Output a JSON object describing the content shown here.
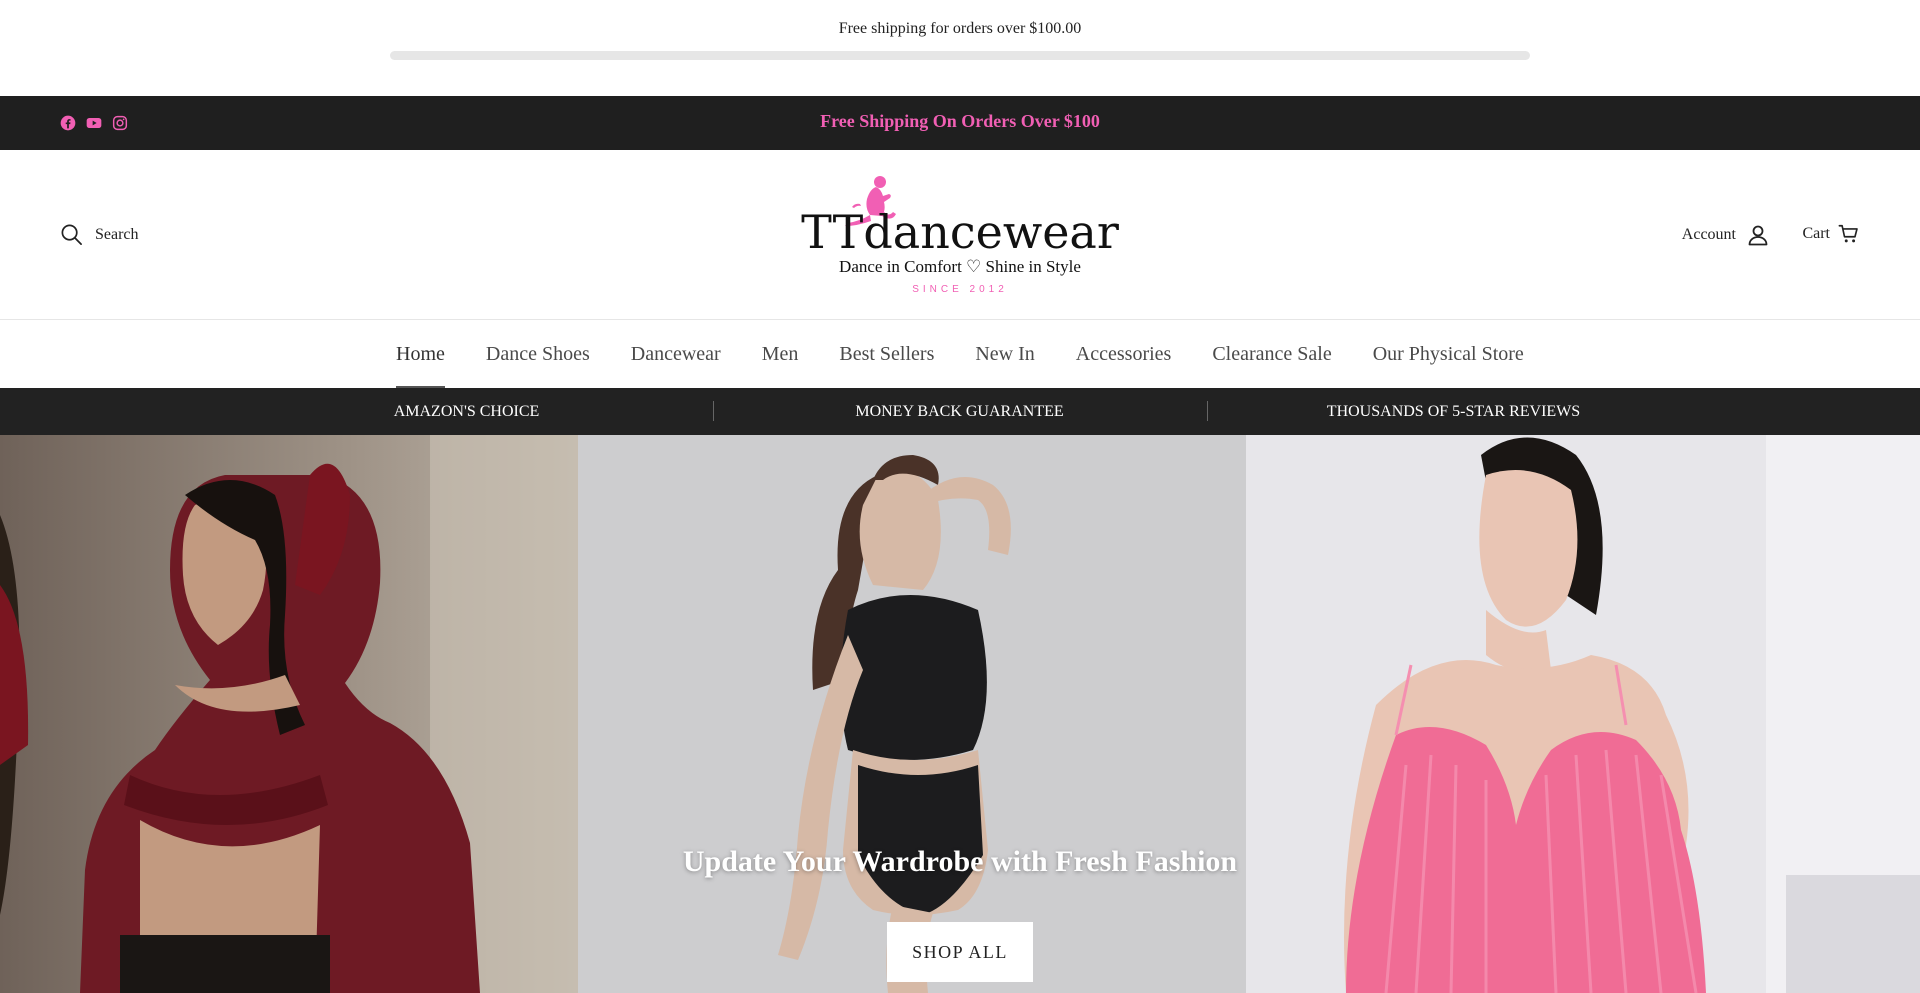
{
  "shipping_bar": {
    "text": "Free shipping for orders over $100.00",
    "progress": 0
  },
  "announcement": {
    "text": "Free Shipping On Orders Over $100"
  },
  "social_icons": [
    "facebook-icon",
    "youtube-icon",
    "instagram-icon"
  ],
  "header": {
    "search_label": "Search",
    "account_label": "Account",
    "cart_label": "Cart",
    "logo": {
      "brand": "TTdancewear",
      "tagline": "Dance in Comfort ♡ Shine in Style",
      "since": "SINCE 2012"
    }
  },
  "nav": {
    "items": [
      {
        "label": "Home",
        "active": true
      },
      {
        "label": "Dance Shoes"
      },
      {
        "label": "Dancewear"
      },
      {
        "label": "Men"
      },
      {
        "label": "Best Sellers"
      },
      {
        "label": "New In"
      },
      {
        "label": "Accessories"
      },
      {
        "label": "Clearance Sale"
      },
      {
        "label": "Our Physical Store"
      }
    ]
  },
  "trust": [
    "AMAZON'S CHOICE",
    "MONEY BACK GUARANTEE",
    "THOUSANDS OF 5-STAR REVIEWS"
  ],
  "hero": {
    "title": "Update Your Wardrobe with Fresh Fashion",
    "button_label": "SHOP ALL"
  },
  "colors": {
    "accent_pink": "#f15fb4",
    "dark_bar": "#1f1f1f",
    "trust_bar": "#222222"
  }
}
